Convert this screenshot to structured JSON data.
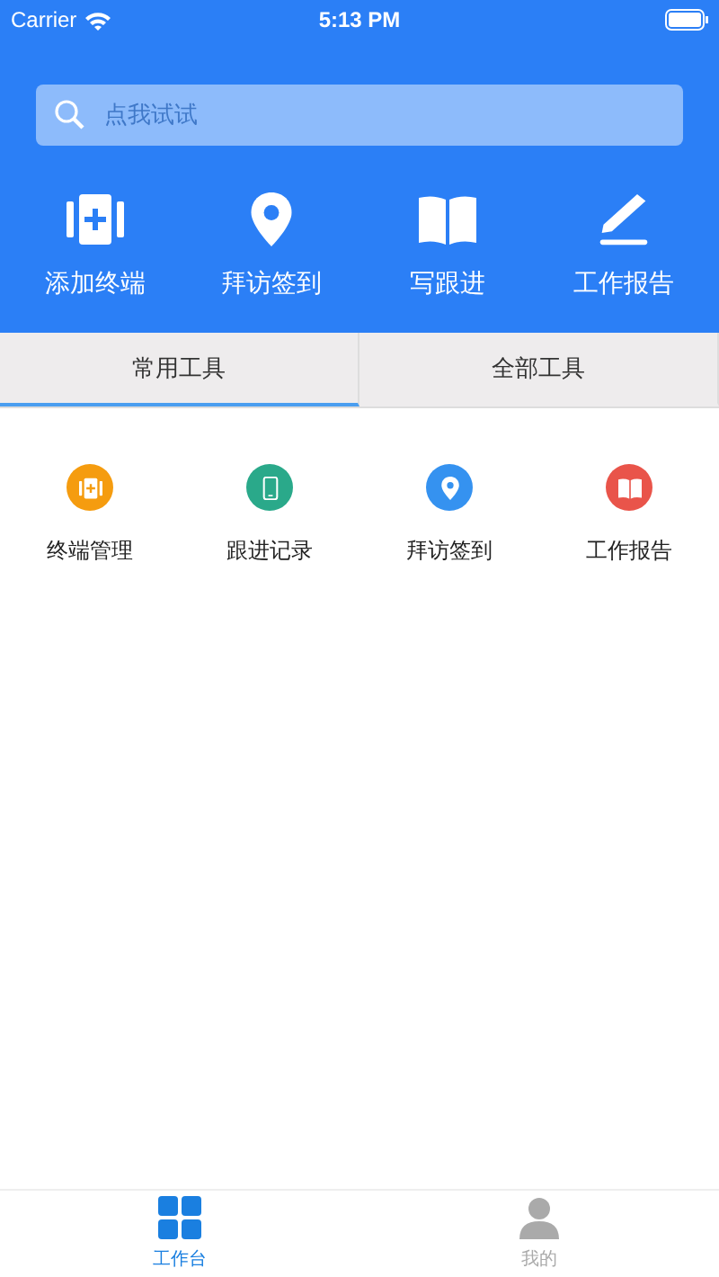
{
  "status_bar": {
    "carrier": "Carrier",
    "time": "5:13 PM"
  },
  "search": {
    "placeholder": "点我试试"
  },
  "actions": [
    {
      "kind": "terminal",
      "label": "添加终端"
    },
    {
      "kind": "pin",
      "label": "拜访签到"
    },
    {
      "kind": "book",
      "label": "写跟进"
    },
    {
      "kind": "pen",
      "label": "工作报告"
    }
  ],
  "tabs": [
    {
      "label": "常用工具",
      "selected": true
    },
    {
      "label": "全部工具",
      "selected": false
    }
  ],
  "tools": [
    {
      "kind": "terminal",
      "label": "终端管理",
      "color": "#f59c0f"
    },
    {
      "kind": "phone",
      "label": "跟进记录",
      "color": "#2aa98a"
    },
    {
      "kind": "pin",
      "label": "拜访签到",
      "color": "#3592f0"
    },
    {
      "kind": "book",
      "label": "工作报告",
      "color": "#e9544a"
    }
  ],
  "bottom_tabs": [
    {
      "kind": "grid",
      "label": "工作台",
      "selected": true
    },
    {
      "kind": "person",
      "label": "我的",
      "selected": false
    }
  ]
}
